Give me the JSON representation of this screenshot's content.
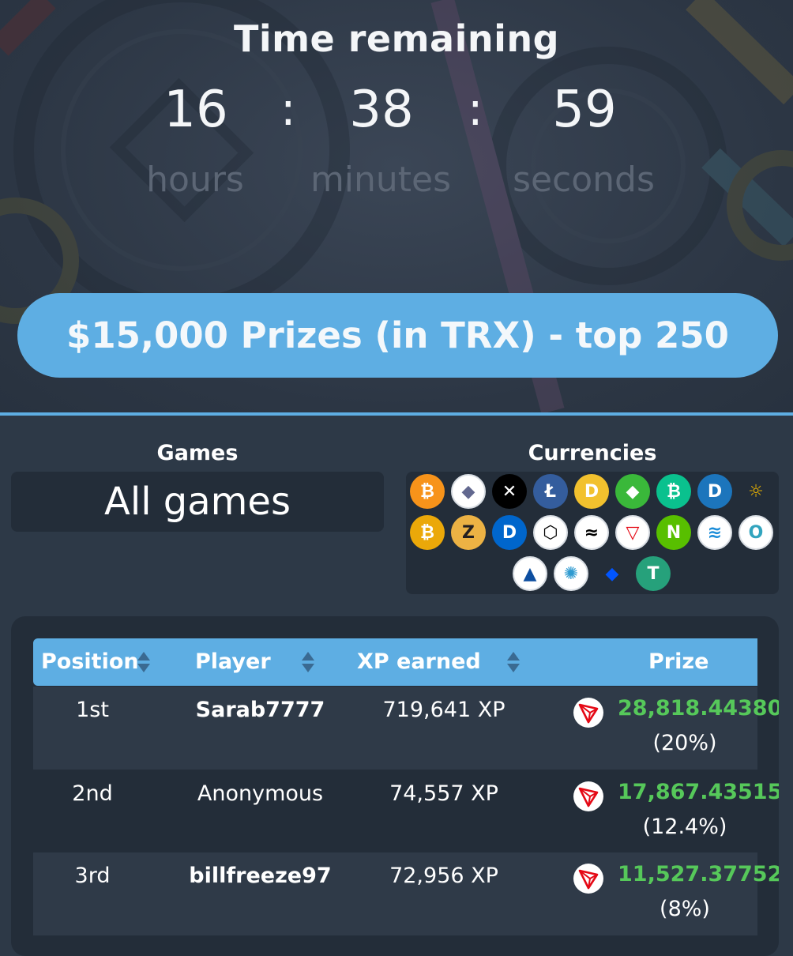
{
  "timer": {
    "title": "Time remaining",
    "hours": "16",
    "minutes": "38",
    "seconds": "59",
    "separator": ":",
    "hours_label": "hours",
    "minutes_label": "minutes",
    "seconds_label": "seconds"
  },
  "banner": {
    "text": "$15,000 Prizes (in TRX) - top 250",
    "color": "#5eaee3"
  },
  "filters": {
    "games_label": "Games",
    "games_value": "All games",
    "currencies_label": "Currencies",
    "currencies": [
      {
        "name": "bitcoin-icon",
        "glyph": "₿",
        "bg": "#f7931a"
      },
      {
        "name": "ethereum-icon",
        "glyph": "◆",
        "bg": "#ffffff",
        "fg": "#62688f"
      },
      {
        "name": "ripple-icon",
        "glyph": "✕",
        "bg": "#000000"
      },
      {
        "name": "litecoin-icon",
        "glyph": "Ł",
        "bg": "#345d9d"
      },
      {
        "name": "dogecoin-icon",
        "glyph": "D",
        "bg": "#f2c12e"
      },
      {
        "name": "ethereum-classic-icon",
        "glyph": "◆",
        "bg": "#3ab83a"
      },
      {
        "name": "bitcoin-cash-icon",
        "glyph": "₿",
        "bg": "#0ac18e"
      },
      {
        "name": "dash-icon",
        "glyph": "D",
        "bg": "#1c75bc"
      },
      {
        "name": "bitcoin-sv-icon",
        "glyph": "☼",
        "bg": "transparent",
        "fg": "#eab300"
      },
      {
        "name": "bitcoin-gold-icon",
        "glyph": "₿",
        "bg": "#eba809"
      },
      {
        "name": "zcash-icon",
        "glyph": "Z",
        "bg": "#ecb244",
        "fg": "#231f20"
      },
      {
        "name": "digibyte-icon",
        "glyph": "D",
        "bg": "#0066cc"
      },
      {
        "name": "eos-icon",
        "glyph": "⬡",
        "bg": "#ffffff",
        "fg": "#000000"
      },
      {
        "name": "stellar-icon",
        "glyph": "≈",
        "bg": "#ffffff",
        "fg": "#000000"
      },
      {
        "name": "tron-icon",
        "glyph": "▽",
        "bg": "#ffffff",
        "fg": "#e50915"
      },
      {
        "name": "neo-icon",
        "glyph": "N",
        "bg": "#58bf00"
      },
      {
        "name": "binance-icon",
        "glyph": "≋",
        "bg": "#ffffff",
        "fg": "#1a8cd8"
      },
      {
        "name": "ontology-icon",
        "glyph": "O",
        "bg": "#ffffff",
        "fg": "#32a4be"
      },
      {
        "name": "lisk-icon",
        "glyph": "▲",
        "bg": "#ffffff",
        "fg": "#0d4ea0"
      },
      {
        "name": "qtum-icon",
        "glyph": "✺",
        "bg": "#ffffff",
        "fg": "#2e9ad0"
      },
      {
        "name": "waves-icon",
        "glyph": "◆",
        "bg": "transparent",
        "fg": "#0155ff"
      },
      {
        "name": "tether-icon",
        "glyph": "T",
        "bg": "#26a17b"
      }
    ]
  },
  "leaderboard": {
    "columns": [
      "Position",
      "Player",
      "XP earned",
      "Prize"
    ],
    "rows": [
      {
        "position": "1st",
        "player": "Sarab7777",
        "player_bold": true,
        "xp": "719,641 XP",
        "prize": "28,818.44380",
        "percent": "(20%)"
      },
      {
        "position": "2nd",
        "player": "Anonymous",
        "player_bold": false,
        "xp": "74,557 XP",
        "prize": "17,867.43515",
        "percent": "(12.4%)"
      },
      {
        "position": "3rd",
        "player": "billfreeze97",
        "player_bold": true,
        "xp": "72,956 XP",
        "prize": "11,527.37752",
        "percent": "(8%)"
      }
    ]
  },
  "colors": {
    "accent": "#5eaee3",
    "prize_green": "#56c85a",
    "panel": "#232d39",
    "background": "#2d3947"
  }
}
